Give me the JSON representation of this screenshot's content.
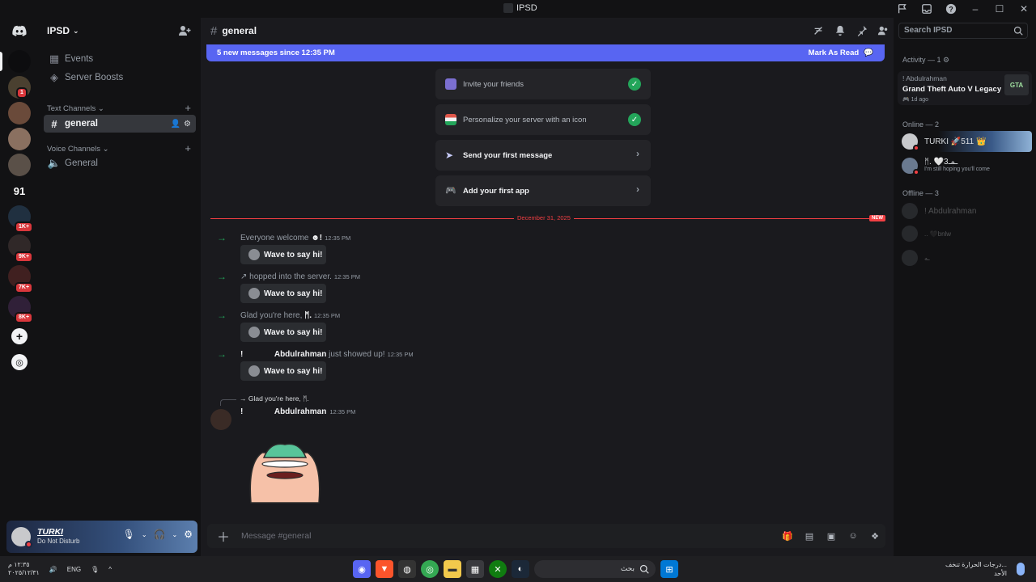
{
  "window": {
    "title": "IPSD"
  },
  "rail": {
    "badges": [
      "1",
      "1K+",
      "9K+",
      "7K+",
      "8K+"
    ],
    "server_91": "91"
  },
  "sidebar": {
    "server_name": "IPSD",
    "events": "Events",
    "boosts": "Server Boosts",
    "text_category": "Text Channels",
    "text_channel": "general",
    "voice_category": "Voice Channels",
    "voice_channel": "General"
  },
  "user": {
    "name": "TURKI",
    "status": "Do Not Disturb"
  },
  "channel": {
    "name": "general",
    "search_placeholder": "Search IPSD"
  },
  "new_messages": {
    "text": "5 new messages since 12:35 PM",
    "action": "Mark As Read"
  },
  "todos": [
    {
      "label": "Invite your friends",
      "done": true
    },
    {
      "label": "Personalize your server with an icon",
      "done": true
    },
    {
      "label": "Send your first message",
      "done": false
    },
    {
      "label": "Add your first app",
      "done": false
    }
  ],
  "divider": {
    "date": "December 31, 2025",
    "tag": "NEW"
  },
  "joins": [
    {
      "pre": "Everyone welcome ",
      "name": "☻!",
      "post": "",
      "time": "12:35 PM",
      "wave": "Wave to say hi!"
    },
    {
      "pre": "",
      "name": "",
      "post": "↗ hopped into the server.",
      "time": "12:35 PM",
      "wave": "Wave to say hi!"
    },
    {
      "pre": "Glad you're here, ",
      "name": "ᛗ.",
      "post": "",
      "time": "12:35 PM",
      "wave": "Wave to say hi!"
    },
    {
      "pre": "",
      "name": "!              Abdulrahman",
      "post": " just showed up!",
      "time": "12:35 PM",
      "wave": "Wave to say hi!"
    }
  ],
  "message": {
    "reply": "→ Glad you're here, ᛗ.",
    "author": "!              Abdulrahman",
    "time": "12:35 PM"
  },
  "composer": {
    "placeholder": "Message #general"
  },
  "members": {
    "activity_header": "Activity — 1 ⚙",
    "activity_user": "! Abdulrahman",
    "activity_game": "Grand Theft Auto V Legacy",
    "activity_ago": "🎮 1d ago",
    "activity_logo": "GTA",
    "online_header": "Online — 2",
    "online": [
      {
        "name": "TURKI  🚀511 👑",
        "sub": ""
      },
      {
        "name": "ᛗ.  🤍ـمـ3",
        "sub": "I'm still hoping you'll come"
      }
    ],
    "offline_header": "Offline — 3",
    "offline": [
      {
        "name": "! Abdulrahman"
      },
      {
        "name": "..   🖤bnlw"
      },
      {
        "name": "ـه"
      }
    ]
  },
  "taskbar": {
    "clock_time": "١٢:٣٥ م",
    "clock_date": "٢٠٢٥/١٢/٣١",
    "lang": "ENG",
    "search_label": "بحث",
    "weather_line1": "درجات الحرارة تنخف...",
    "weather_line2": "الأحد"
  }
}
